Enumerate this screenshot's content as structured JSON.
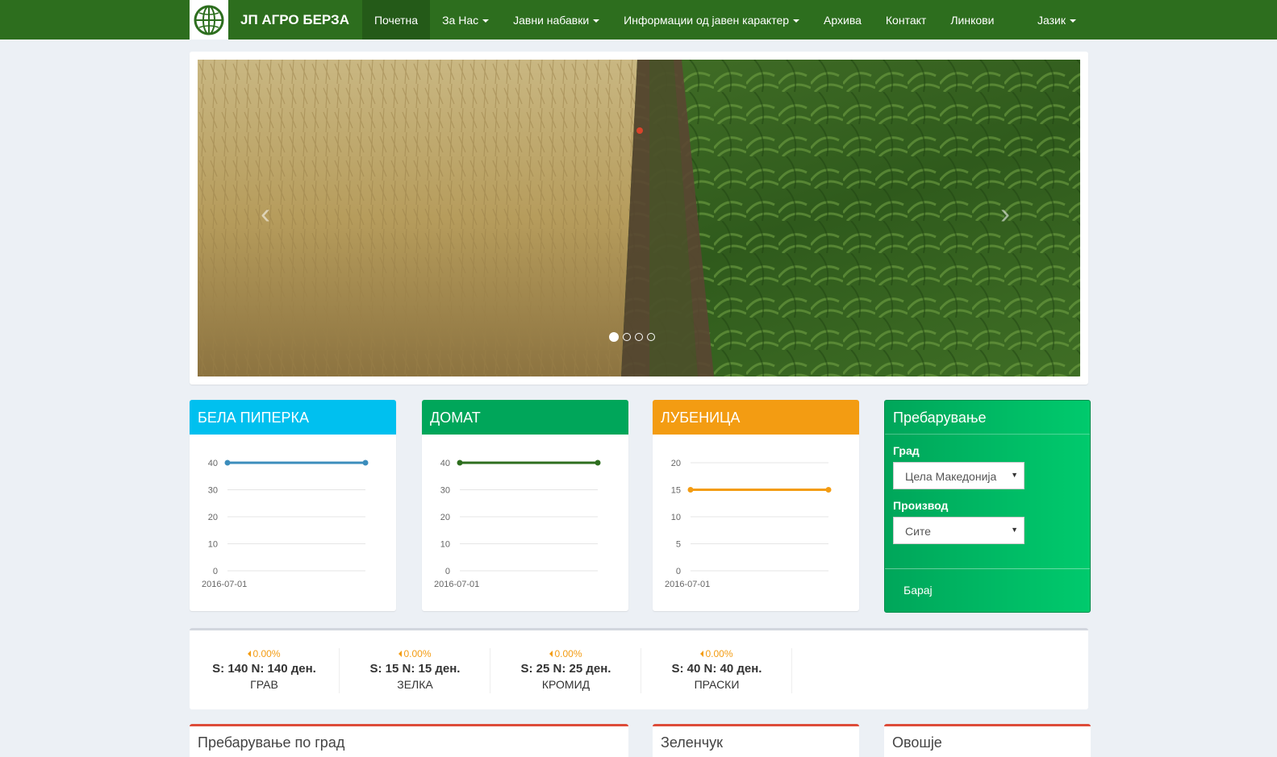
{
  "nav": {
    "brand": "ЈП АГРО БЕРЗА",
    "items": [
      {
        "label": "Почетна",
        "active": true,
        "dropdown": false
      },
      {
        "label": "За Нас",
        "active": false,
        "dropdown": true
      },
      {
        "label": "Јавни набавки",
        "active": false,
        "dropdown": true
      },
      {
        "label": "Информации од јавен карактер",
        "active": false,
        "dropdown": true
      },
      {
        "label": "Архива",
        "active": false,
        "dropdown": false
      },
      {
        "label": "Контакт",
        "active": false,
        "dropdown": false
      },
      {
        "label": "Линкови",
        "active": false,
        "dropdown": false
      }
    ],
    "language": "Јазик"
  },
  "carousel": {
    "slides": 4,
    "active": 0
  },
  "charts": [
    {
      "title": "БЕЛА ПИПЕРКА",
      "header_color": "#00c0ef",
      "line_color": "#3c8dbc",
      "chart_data": {
        "type": "line",
        "x": [
          "2016-07-01",
          "2016-07-01"
        ],
        "values": [
          40,
          40
        ],
        "ylim": [
          0,
          40
        ],
        "yticks": [
          0,
          10,
          20,
          30,
          40
        ],
        "xtick": "2016-07-01"
      }
    },
    {
      "title": "ДОМАТ",
      "header_color": "#00a65a",
      "line_color": "#2d6e1e",
      "chart_data": {
        "type": "line",
        "x": [
          "2016-07-01",
          "2016-07-01"
        ],
        "values": [
          40,
          40
        ],
        "ylim": [
          0,
          40
        ],
        "yticks": [
          0,
          10,
          20,
          30,
          40
        ],
        "xtick": "2016-07-01"
      }
    },
    {
      "title": "ЛУБЕНИЦА",
      "header_color": "#f39c12",
      "line_color": "#f39c12",
      "chart_data": {
        "type": "line",
        "x": [
          "2016-07-01",
          "2016-07-01"
        ],
        "values": [
          15,
          15
        ],
        "ylim": [
          0,
          20
        ],
        "yticks": [
          0,
          5,
          10,
          15,
          20
        ],
        "xtick": "2016-07-01"
      }
    }
  ],
  "search": {
    "title": "Пребарување",
    "city_label": "Град",
    "city_value": "Цела Македонија",
    "product_label": "Производ",
    "product_value": "Сите",
    "submit": "Барај"
  },
  "ticker": [
    {
      "pct": "0.00%",
      "value": "S: 140 N: 140 ден.",
      "name": "ГРАВ"
    },
    {
      "pct": "0.00%",
      "value": "S: 15 N: 15 ден.",
      "name": "ЗЕЛКА"
    },
    {
      "pct": "0.00%",
      "value": "S: 25 N: 25 ден.",
      "name": "КРОМИД"
    },
    {
      "pct": "0.00%",
      "value": "S: 40 N: 40 ден.",
      "name": "ПРАСКИ"
    }
  ],
  "bottom": {
    "by_city": "Пребарување по град",
    "vegetables": "Зеленчук",
    "fruits": "Овошје"
  },
  "colors": {
    "nav": "#2d6e1e",
    "accent_red": "#dd4b39",
    "background": "#ecf0f5"
  }
}
